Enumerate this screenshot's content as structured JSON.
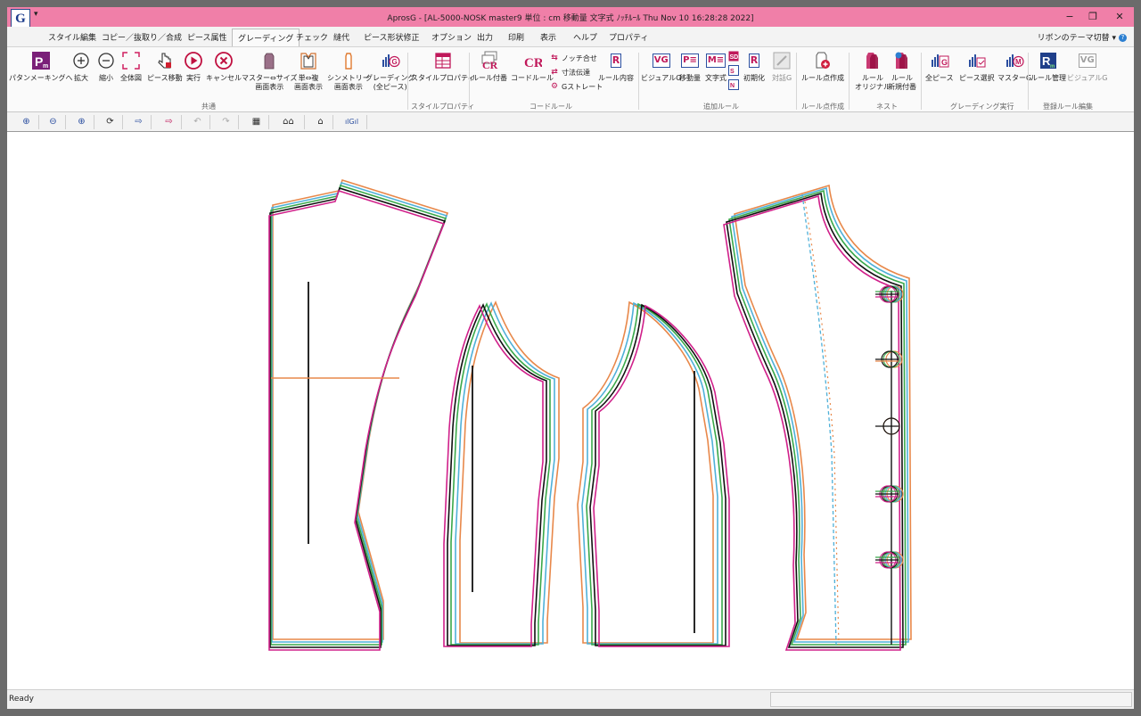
{
  "window": {
    "logo": "G",
    "qat": "▾",
    "title": "AprosG - [AL-5000-NOSK   master9   単位 : cm     移動量   文字式   ﾉｯﾁﾙｰﾙ   Thu Nov 10 16:28:28 2022]",
    "min": "−",
    "restore": "❐",
    "close": "✕"
  },
  "menu": {
    "tabs": [
      "スタイル編集",
      "コピー／抜取り／合成",
      "ピース属性",
      "グレーディング",
      "チェック",
      "縫代",
      "ピース形状修正",
      "オプション",
      "出力",
      "印刷",
      "表示",
      "ヘルプ",
      "プロパティ"
    ],
    "theme": "リボンのテーマ切替 ▾",
    "help": "?"
  },
  "ribbon": {
    "common": {
      "pm": "パタンメーキングへ",
      "zoom_in": "拡大",
      "zoom_out": "縮小",
      "full": "全体図",
      "move_piece": "ピース移動",
      "run": "実行",
      "cancel": "キャンセル",
      "master_size_1": "マスター⇔サイズ",
      "master_size_2": "画面表示",
      "single_multi_1": "単⇔複",
      "single_multi_2": "画面表示",
      "symmetry_1": "シンメトリー",
      "symmetry_2": "画面表示",
      "grading_all_1": "グレーディング",
      "grading_all_2": "(全ピース)",
      "group": "共通"
    },
    "style": {
      "prop": "スタイルプロパティ",
      "group": "スタイルプロパティ"
    },
    "code": {
      "attach": "ルール付番",
      "code_rule": "コードルール",
      "notch": "ノッチ合せ",
      "dim": "寸法伝達",
      "straight": "Gストレート",
      "content": "ルール内容",
      "group": "コードルール"
    },
    "add": {
      "visual": "ビジュアルG",
      "move": "移動量",
      "formula": "文字式",
      "init": "初期化",
      "dialog": "対話G",
      "group": "追加ルール"
    },
    "point": {
      "make": "ルール点作成",
      "group": "ルール点作成"
    },
    "nest": {
      "orig_1": "ルール",
      "orig_2": "オリジナル",
      "new_1": "ルール",
      "new_2": "新規付番",
      "group": "ネスト"
    },
    "exec": {
      "all": "全ピース",
      "select": "ピース選択",
      "master": "マスターG",
      "group": "グレーディング実行"
    },
    "reg": {
      "manage": "ルール管理",
      "visual": "ビジュアルG",
      "group": "登録ルール編集"
    }
  },
  "toolbar": {
    "z1": "⊕",
    "z2": "⊖",
    "z3": "⊕",
    "rot": "⟳",
    "fwd": "⇨",
    "fwd2": "⇨",
    "undo": "↶",
    "redo": "↷",
    "t9": "▦",
    "t10": "⌂⌂",
    "t11": "⌂",
    "t12": "ılGıl"
  },
  "status": {
    "text": "Ready"
  },
  "colors": {
    "titlebar": "#f07fa8",
    "grade_orange": "#e8884a",
    "grade_blue": "#4fb0d8",
    "grade_green": "#3aa84a",
    "grade_black": "#111111",
    "grade_magenta": "#d0208a"
  }
}
